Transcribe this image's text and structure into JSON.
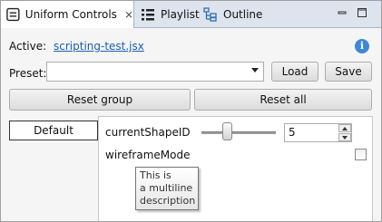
{
  "tabs": [
    {
      "label": "Uniform Controls",
      "icon": "controls-icon",
      "active": true,
      "close": "⨯"
    },
    {
      "label": "Playlist",
      "icon": "playlist-icon",
      "active": false
    },
    {
      "label": "Outline",
      "icon": "outline-icon",
      "active": false
    }
  ],
  "window_controls": [
    "minimize-icon",
    "maximize-icon"
  ],
  "active": {
    "label": "Active:",
    "file": "scripting-test.jsx"
  },
  "info_icon": "i",
  "preset": {
    "label": "Preset:",
    "value": ""
  },
  "buttons": {
    "load": "Load",
    "save": "Save",
    "reset_group": "Reset group",
    "reset_all": "Reset all"
  },
  "group": {
    "name": "Default"
  },
  "uniforms": {
    "current_shape_id": {
      "label": "currentShapeID",
      "value": "5",
      "slider_fraction": 0.33
    },
    "wireframe_mode": {
      "label": "wireframeMode",
      "checked": false
    }
  },
  "tooltip": {
    "lines": [
      "This is",
      "a multiline",
      "description"
    ]
  },
  "colors": {
    "tabbar": "#dde4ee",
    "link": "#1a5fb4",
    "info": "#3f88d8",
    "panel": "#f5f5f5"
  }
}
